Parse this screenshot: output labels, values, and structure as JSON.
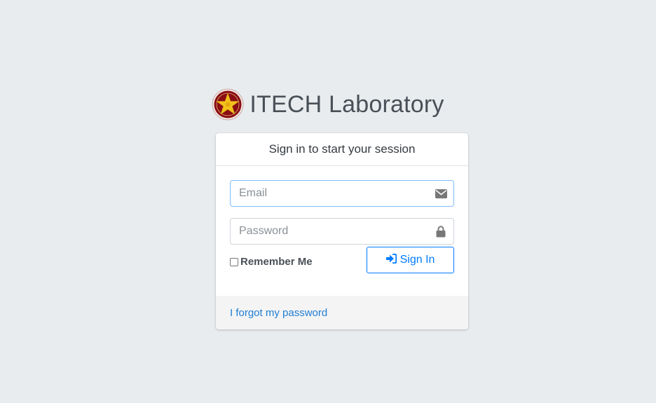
{
  "brand": {
    "logo_icon": "star-seal-emblem",
    "name_strong": "ITECH",
    "name_light": "Laboratory"
  },
  "login": {
    "header": "Sign in to start your session",
    "email": {
      "placeholder": "Email",
      "value": "",
      "icon": "envelope-icon"
    },
    "password": {
      "placeholder": "Password",
      "value": "",
      "icon": "lock-icon"
    },
    "remember_label": "Remember Me",
    "remember_checked": false,
    "signin_label": "Sign In",
    "signin_icon": "sign-in-icon",
    "forgot_label": "I forgot my password"
  },
  "colors": {
    "background": "#e9ecef",
    "accent": "#007bff",
    "link": "#1f7dd4",
    "emblem_red": "#8b0d14",
    "emblem_gold": "#f2c21b"
  }
}
